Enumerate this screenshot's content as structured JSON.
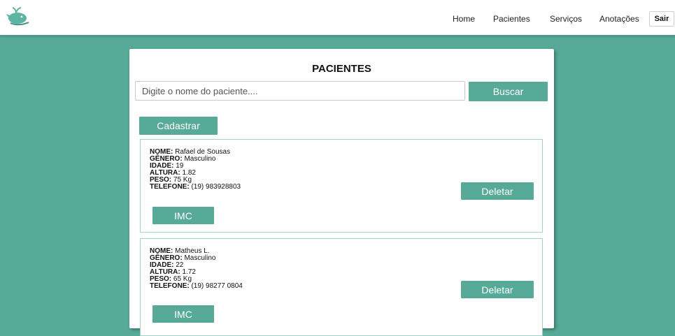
{
  "nav": {
    "links": [
      "Home",
      "Pacientes",
      "Serviços",
      "Anotações"
    ],
    "logout_label": "Sair"
  },
  "page": {
    "title": "PACIENTES",
    "search_placeholder": "Digite o nome do paciente....",
    "search_button": "Buscar",
    "register_button": "Cadastrar"
  },
  "labels": {
    "nome": "NOME:",
    "genero": "GÊNERO:",
    "idade": "IDADE:",
    "altura": "ALTURA:",
    "peso": "PESO:",
    "telefone": "TELEFONE:"
  },
  "patients": [
    {
      "nome": "Rafael de Sousas",
      "genero": "Masculino",
      "idade": "19",
      "altura": "1.82",
      "peso": "75 Kg",
      "telefone": "(19) 983928803",
      "delete_label": "Deletar",
      "imc_label": "IMC"
    },
    {
      "nome": "Matheus L.",
      "genero": "Masculino",
      "idade": "22",
      "altura": "1.72",
      "peso": "65 Kg",
      "telefone": "(19) 98277 0804",
      "delete_label": "Deletar",
      "imc_label": "IMC"
    }
  ],
  "colors": {
    "accent": "#57a998",
    "card_border": "#9fd3c8"
  },
  "icons": {
    "logo": "green-whale-logo-icon"
  }
}
